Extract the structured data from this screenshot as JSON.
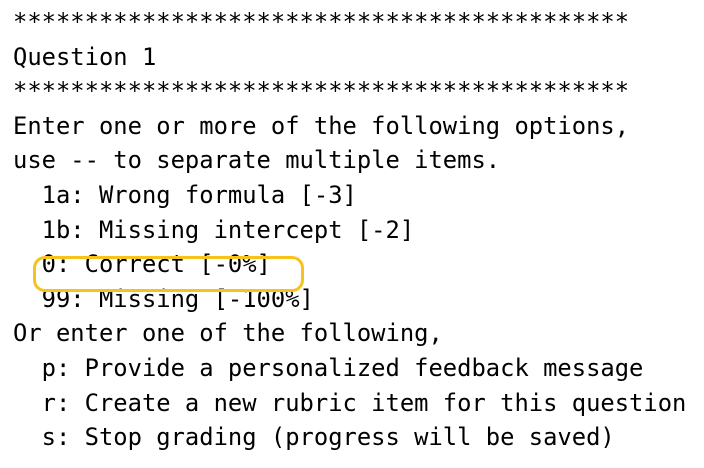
{
  "terminal": {
    "separator": "*******************************************",
    "question_title": "Question 1",
    "instructions": [
      "Enter one or more of the following options,",
      "use -- to separate multiple items."
    ],
    "rubric_items": [
      "  1a: Wrong formula [-3]",
      "  1b: Missing intercept [-2]",
      "  0: Correct [-0%]",
      "  99: Missing [-100%]"
    ],
    "other_prompt": "Or enter one of the following,",
    "commands": [
      "  p: Provide a personalized feedback message",
      "  r: Create a new rubric item for this question",
      "  s: Stop grading (progress will be saved)"
    ],
    "highlight_color": "#f7c21b"
  }
}
